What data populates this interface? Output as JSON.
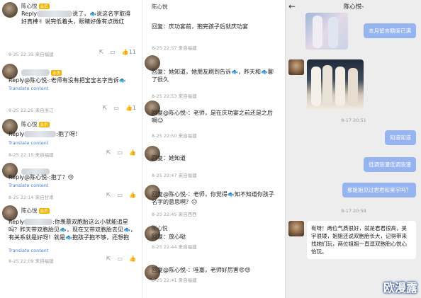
{
  "panel1": {
    "comments": [
      {
        "name": "陈心悦",
        "badge": "会员",
        "text_pre": "Reply",
        "text": "说了，🐟说这名字取得好真棒✌ 说完低着头，眼睛好像有点微红",
        "meta": "8-25 22:33 来自福建",
        "likes": "11"
      },
      {
        "name": "",
        "badge": "",
        "text_pre": "Reply@陈心悦-",
        "text": ":老师有没有把宝宝名字告诉🐟",
        "translate": "Translate content",
        "meta": "8-25 22:25 来自浙江",
        "likes": "1"
      },
      {
        "name": "陈心悦",
        "badge": "会员",
        "text_pre": "Reply",
        "text": ":抱了呀！",
        "translate": "Translate content",
        "meta": "8-25 22:15 来自福建",
        "likes": ""
      },
      {
        "name": "",
        "badge": "",
        "text_pre": "Reply@陈心悦-",
        "text": ":抱了？😢",
        "translate": "Translate content",
        "meta": "8-25 22:14 来自甘肃",
        "likes": ""
      },
      {
        "name": "陈心悦",
        "badge": "会员",
        "text_pre": "Reply",
        "text": ":你羡慕双胞胎这么小就能追星吗？昨天带双胞胎见🐟，现在又带双胞胎去见🐟，有关系就是好呀！就是🐟抱孩子抱不够，还想抱",
        "translate": "Translate content",
        "meta": "8-25 22:09 来自福建",
        "likes": ""
      }
    ]
  },
  "panel2": {
    "comments": [
      {
        "name": "陈心悦",
        "text": "回复：庆功宴前，抱完孩子后就庆功宴",
        "meta": "8-25 22:57 来自福建",
        "likes": ""
      },
      {
        "name": "",
        "text": "回复：她知道，她朋友刷到告诉🐟，昨天和🐟聊了很久",
        "meta": "8-25 22:53 来自福建",
        "likes": ""
      },
      {
        "name": "",
        "text": "回复@陈心悦-：老师，是在庆功宴之前还是之后啊😐",
        "meta": "8-25 22:50 来自福建",
        "likes": ""
      },
      {
        "name": "",
        "text": "回复：她知道",
        "meta": "8-25 22:47 来自福建",
        "likes": ""
      },
      {
        "name": "",
        "text": "回复@陈心悦-：老师，你觉得🐟知不知道你孩子名字的意思啊？😐",
        "meta": "8-25 22:45 来自西西",
        "likes": ""
      },
      {
        "name": "陈心悦",
        "text": "回复：放心哒",
        "meta": "8-25 22:44 来自福建",
        "likes": ""
      },
      {
        "name": "",
        "text": "回复@陈心悦-：哇塞，老师好厉害😍😍",
        "meta": "8-25 22:41 来自福建",
        "likes": ""
      }
    ]
  },
  "chat": {
    "back_icon": "←",
    "title": "陈心悦-",
    "messages": [
      {
        "side": "right",
        "text": "本月留言额度已满"
      },
      {
        "ts": "8-17 20:51"
      },
      {
        "side": "right",
        "text": "知道知道"
      },
      {
        "side": "right",
        "text": "低调浪漫低调浪漫"
      },
      {
        "side": "right",
        "text": "那姐姐见过君君和昊宇吗？"
      },
      {
        "ts": "8-17 20:58"
      },
      {
        "side": "left",
        "text": "有呀！两位气质很好，就是君君很高，昊宇很矮，姐姐还说双胞胎长大，记得带来找她们玩，两位姐姐一直逗双胞胎心悦心怡玩。"
      }
    ],
    "watermark": "欧漫露"
  },
  "colors": {
    "blue_bubble": "#95b4f0",
    "chat_bg": "#ededed",
    "link": "#4a7bd0"
  }
}
